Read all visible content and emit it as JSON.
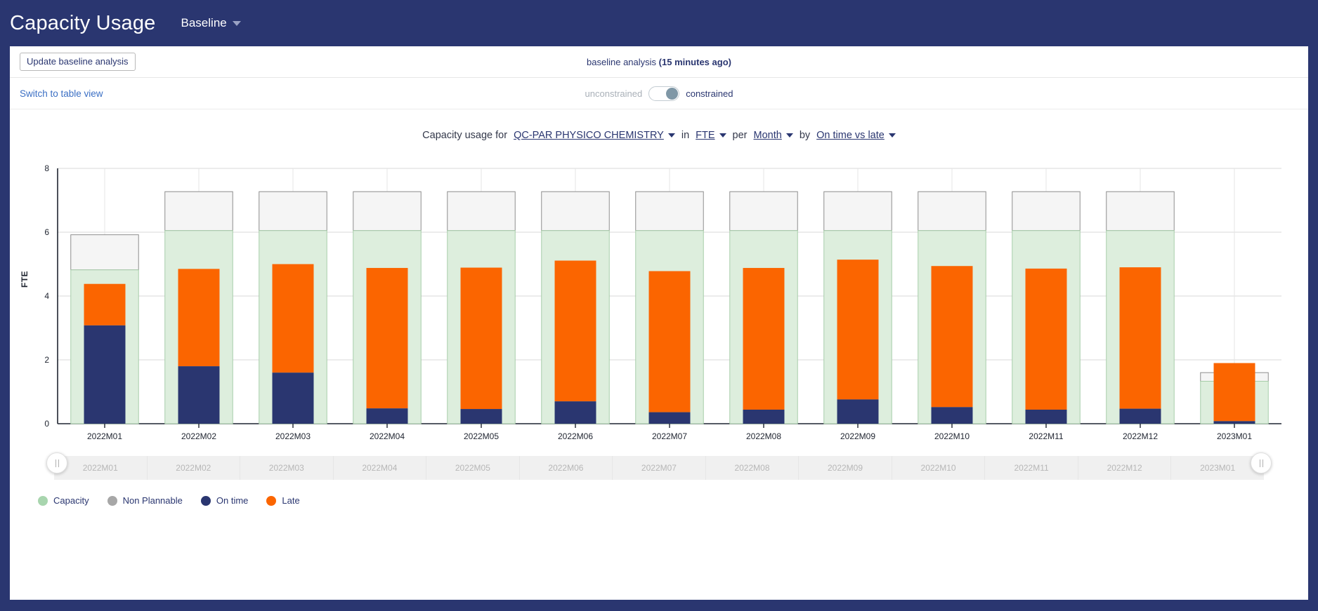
{
  "header": {
    "title": "Capacity Usage",
    "view_selector_label": "Baseline",
    "view_caret_icon": "chevron-down-icon"
  },
  "toolbar": {
    "update_button_label": "Update baseline analysis",
    "status_prefix": "baseline analysis",
    "status_age": "(15 minutes ago)"
  },
  "subtoolbar": {
    "table_view_link": "Switch to table view",
    "toggle_left_label": "unconstrained",
    "toggle_right_label": "constrained",
    "toggle_state": "constrained"
  },
  "filters": {
    "prefix": "Capacity usage for",
    "entity": "QC-PAR PHYSICO CHEMISTRY",
    "in_label": "in",
    "unit": "FTE",
    "per_label": "per",
    "period": "Month",
    "by_label": "by",
    "grouping": "On time vs late"
  },
  "legend": [
    {
      "label": "Capacity",
      "color": "#a8d5ae"
    },
    {
      "label": "Non Plannable",
      "color": "#a7a7a7"
    },
    {
      "label": "On time",
      "color": "#2a3670"
    },
    {
      "label": "Late",
      "color": "#fb6500"
    }
  ],
  "range_slider": {
    "left_handle_icon": "drag-handle-icon",
    "right_handle_icon": "drag-handle-icon",
    "ticks": [
      "2022M01",
      "2022M02",
      "2022M03",
      "2022M04",
      "2022M05",
      "2022M06",
      "2022M07",
      "2022M08",
      "2022M09",
      "2022M10",
      "2022M11",
      "2022M12",
      "2023M01"
    ]
  },
  "chart_data": {
    "type": "bar",
    "subtype": "stacked-with-capacity-background",
    "title": "",
    "xlabel": "",
    "ylabel": "FTE",
    "ylim": [
      0,
      8
    ],
    "yticks": [
      0,
      2,
      4,
      6,
      8
    ],
    "grid": true,
    "legend_position": "bottom-left",
    "categories": [
      "2022M01",
      "2022M02",
      "2022M03",
      "2022M04",
      "2022M05",
      "2022M06",
      "2022M07",
      "2022M08",
      "2022M09",
      "2022M10",
      "2022M11",
      "2022M12",
      "2023M01"
    ],
    "series": [
      {
        "name": "Capacity",
        "color": "#ddeedd",
        "values": [
          4.82,
          6.05,
          6.05,
          6.05,
          6.05,
          6.05,
          6.05,
          6.05,
          6.05,
          6.05,
          6.05,
          6.05,
          1.33
        ]
      },
      {
        "name": "Non Plannable",
        "color": "#f5f5f5",
        "values": [
          5.92,
          7.27,
          7.27,
          7.27,
          7.27,
          7.27,
          7.27,
          7.27,
          7.27,
          7.27,
          7.27,
          7.27,
          1.6
        ]
      },
      {
        "name": "On time",
        "color": "#2a3670",
        "values": [
          3.08,
          1.8,
          1.6,
          0.48,
          0.46,
          0.7,
          0.36,
          0.44,
          0.76,
          0.52,
          0.44,
          0.47,
          0.08
        ]
      },
      {
        "name": "Late",
        "color": "#fb6500",
        "values": [
          1.3,
          3.05,
          3.4,
          4.4,
          4.43,
          4.41,
          4.42,
          4.44,
          4.38,
          4.42,
          4.42,
          4.43,
          1.82
        ]
      }
    ],
    "totals": [
      4.38,
      4.85,
      5.0,
      4.88,
      4.89,
      5.11,
      4.78,
      4.88,
      5.14,
      4.94,
      4.86,
      4.9,
      1.9
    ]
  }
}
